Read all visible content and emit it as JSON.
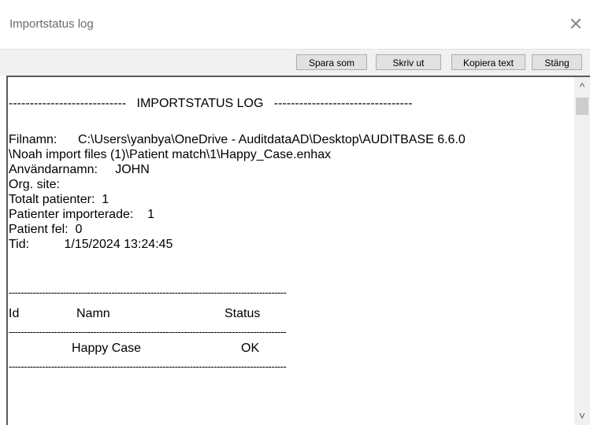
{
  "window": {
    "title": "Importstatus log",
    "close_glyph": "✕"
  },
  "toolbar": {
    "buttons": [
      {
        "label": "Spara som"
      },
      {
        "label": "Skriv ut"
      },
      {
        "label": "Kopiera text"
      },
      {
        "label": "Stäng"
      }
    ]
  },
  "log": {
    "header": "----------------------------   IMPORTSTATUS LOG   ---------------------------------",
    "filnamn_line1": "Filnamn:      C:\\Users\\yanbya\\OneDrive - AuditdataAD\\Desktop\\AUDITBASE 6.6.0",
    "filnamn_line2": "\\Noah import files (1)\\Patient match\\1\\Happy_Case.enhax",
    "anvandarnamn": "Användarnamn:     JOHN",
    "org_site": "Org. site:",
    "totalt": "Totalt patienter:  1",
    "importerade": "Patienter importerade:    1",
    "fel": "Patient fel:  0",
    "tid": "Tid:          1/15/2024 13:24:45",
    "divider": "--------------------------------------------------------------------------------------------",
    "col_id": "Id",
    "col_namn": "Namn",
    "col_status": "Status",
    "row_namn": "Happy Case",
    "row_status": "OK"
  },
  "scrollbar": {
    "up_glyph": "^",
    "down_glyph": "˅"
  }
}
